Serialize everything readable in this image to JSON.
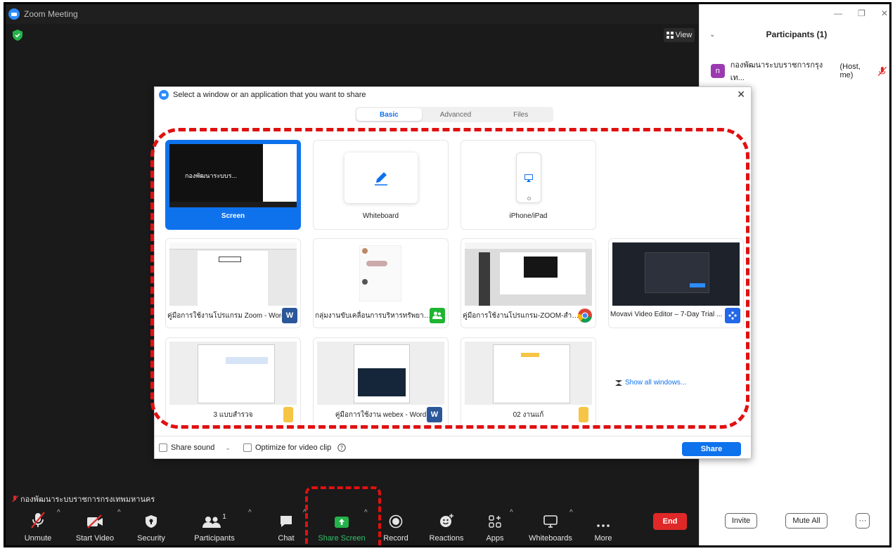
{
  "window": {
    "title": "Zoom Meeting"
  },
  "meeting": {
    "view_label": "View",
    "self_name": "กองพัฒนาระบบราชการกรุงเทพมหานคร"
  },
  "toolbar": {
    "unmute": "Unmute",
    "start_video": "Start Video",
    "security": "Security",
    "participants": "Participants",
    "participants_count": "1",
    "chat": "Chat",
    "share_screen": "Share Screen",
    "record": "Record",
    "reactions": "Reactions",
    "apps": "Apps",
    "whiteboards": "Whiteboards",
    "more": "More",
    "end": "End"
  },
  "panel": {
    "title": "Participants (1)",
    "participant": {
      "initial": "n",
      "name": "กองพัฒนาระบบราชการกรุงเท...",
      "role": "(Host, me)"
    },
    "invite": "Invite",
    "mute_all": "Mute All",
    "more_glyph": "···"
  },
  "dialog": {
    "title": "Select a window or an application that you want to share",
    "tabs": [
      "Basic",
      "Advanced",
      "Files"
    ],
    "screen_thumb_text": "กองพัฒนาระบบร...",
    "tiles": [
      {
        "label": "Screen"
      },
      {
        "label": "Whiteboard"
      },
      {
        "label": "iPhone/iPad"
      },
      {
        "label": "คู่มือการใช้งานโปรแกรม Zoom - Word"
      },
      {
        "label": "กลุ่มงานขับเคลื่อนการบริหารทรัพยากรบ..."
      },
      {
        "label": "คู่มือการใช้งานโปรแกรม-ZOOM-สำหรั..."
      },
      {
        "label": "Movavi Video Editor – 7-Day Trial ..."
      },
      {
        "label": "3 แบบสำรวจ"
      },
      {
        "label": "คู่มือการใช้งาน webex - Word"
      },
      {
        "label": "02 งานแก้"
      }
    ],
    "show_all": "Show all windows...",
    "share_sound": "Share sound",
    "optimize": "Optimize for video clip",
    "share_button": "Share"
  },
  "colors": {
    "accent": "#0e72ed",
    "end": "#e02828",
    "highlight": "#e01010"
  }
}
